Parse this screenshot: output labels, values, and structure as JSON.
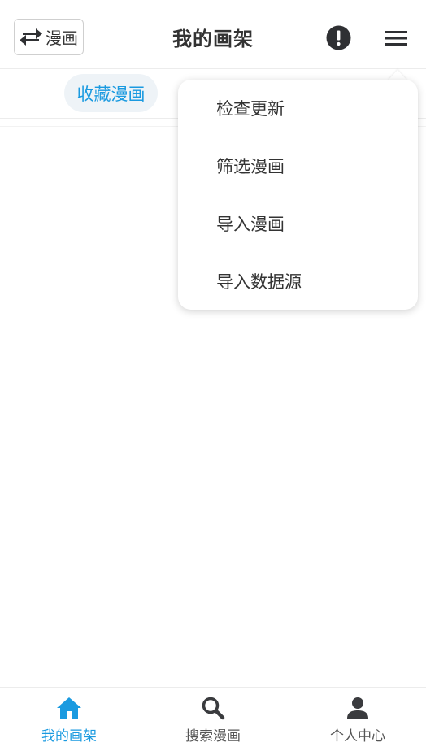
{
  "header": {
    "switch_label": "漫画",
    "title": "我的画架"
  },
  "tabs": [
    {
      "label": "收藏漫画",
      "active": true
    }
  ],
  "dropdown": {
    "items": [
      {
        "label": "检查更新"
      },
      {
        "label": "筛选漫画"
      },
      {
        "label": "导入漫画"
      },
      {
        "label": "导入数据源"
      }
    ]
  },
  "bottom_nav": {
    "items": [
      {
        "label": "我的画架",
        "icon": "home-icon",
        "active": true
      },
      {
        "label": "搜索漫画",
        "icon": "search-icon",
        "active": false
      },
      {
        "label": "个人中心",
        "icon": "person-icon",
        "active": false
      }
    ]
  },
  "colors": {
    "accent": "#1a9ae0",
    "text": "#333333",
    "tab_bg": "#eef3f7",
    "icon_dark": "#2f3033"
  }
}
